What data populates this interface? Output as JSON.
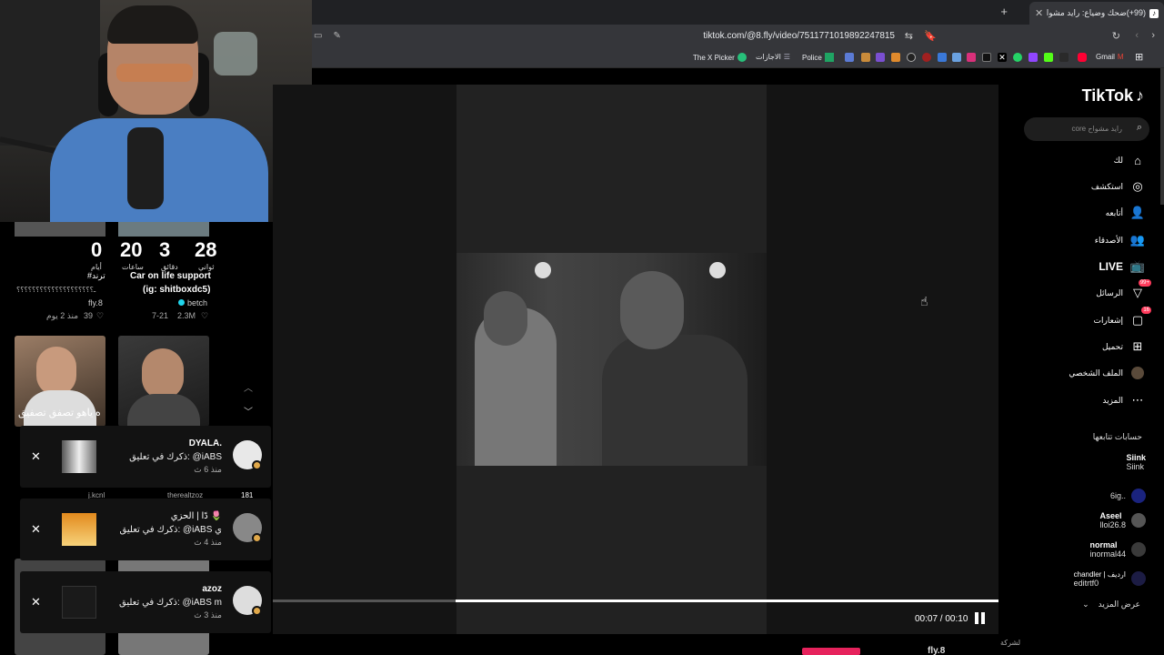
{
  "browser": {
    "tab_title": "(99+)ضحك وضياع: رايد مشواح",
    "tab_favicon": "tiktok-icon",
    "url": "tiktok.com/@8.fly/video/7511771019892247815",
    "bookmarks": [
      "Gmail",
      "Police",
      "الاجازات",
      "The X Picker"
    ]
  },
  "feed": {
    "counters": [
      {
        "value": "0",
        "label": "أيام"
      },
      {
        "value": "20",
        "label": "ساعات"
      },
      {
        "value": "3",
        "label": "دقائق"
      },
      {
        "value": "28",
        "label": "ثواني"
      }
    ],
    "top_tag": "#ترند",
    "video_left": {
      "title": "ـ؟؟؟؟؟؟؟؟؟؟؟؟؟؟؟؟؟؟؟؟",
      "author": "fly.8",
      "likes": "39",
      "date": "منذ 2 يوم"
    },
    "video_right": {
      "title": "Car on life support",
      "subtitle": "(ig: shitboxdc5)",
      "author": "betch",
      "likes": "2.3M",
      "date": "7-21"
    },
    "caption": "ه ياهو تصفق تصفيق",
    "partial_left": "j.kcnl",
    "partial_right": "therealtzoz",
    "partial_count": "181"
  },
  "notifications": [
    {
      "name": "DYALA.",
      "text": "ذكرك في تعليق: @iABS",
      "time": "منذ 6 ث"
    },
    {
      "name": "دًا | الحزي 🌷",
      "text": "ذكرك في تعليق: @iABS ي",
      "time": "منذ 4 ث"
    },
    {
      "name": "azoz",
      "text": "ذكرك في تعليق: @iABS m",
      "time": "منذ 3 ث"
    }
  ],
  "player": {
    "time": "00:07 / 00:10",
    "progress": 0.7,
    "author": "fly.8"
  },
  "sidebar": {
    "logo": "TikTok",
    "search_placeholder": "رايد مشواح core",
    "nav": [
      {
        "label": "لك",
        "icon": "home-icon"
      },
      {
        "label": "استكشف",
        "icon": "compass-icon"
      },
      {
        "label": "أتابعه",
        "icon": "user-plus-icon"
      },
      {
        "label": "الأصدقاء",
        "icon": "friends-icon"
      },
      {
        "label": "LIVE",
        "icon": "live-tv-icon"
      },
      {
        "label": "الرسائل",
        "icon": "message-icon",
        "badge": "99+"
      },
      {
        "label": "إشعارات",
        "icon": "bell-icon",
        "badge": "16"
      },
      {
        "label": "تحميل",
        "icon": "upload-icon"
      },
      {
        "label": "الملف الشخصي",
        "icon": "avatar-icon"
      },
      {
        "label": "المزيد",
        "icon": "more-icon"
      }
    ],
    "following_title": "حسابات تتابعها",
    "following": [
      {
        "username": "Siink",
        "display": "Siink"
      },
      {
        "username": "",
        "display": "6ig.."
      },
      {
        "username": "Aseel",
        "display": "lloi26.8"
      },
      {
        "username": "normal",
        "display": "inormal44"
      },
      {
        "username": "chandler | اردیف",
        "display": "editrtf0"
      }
    ],
    "see_more": "عرض المزيد",
    "footer": "لشركة"
  }
}
